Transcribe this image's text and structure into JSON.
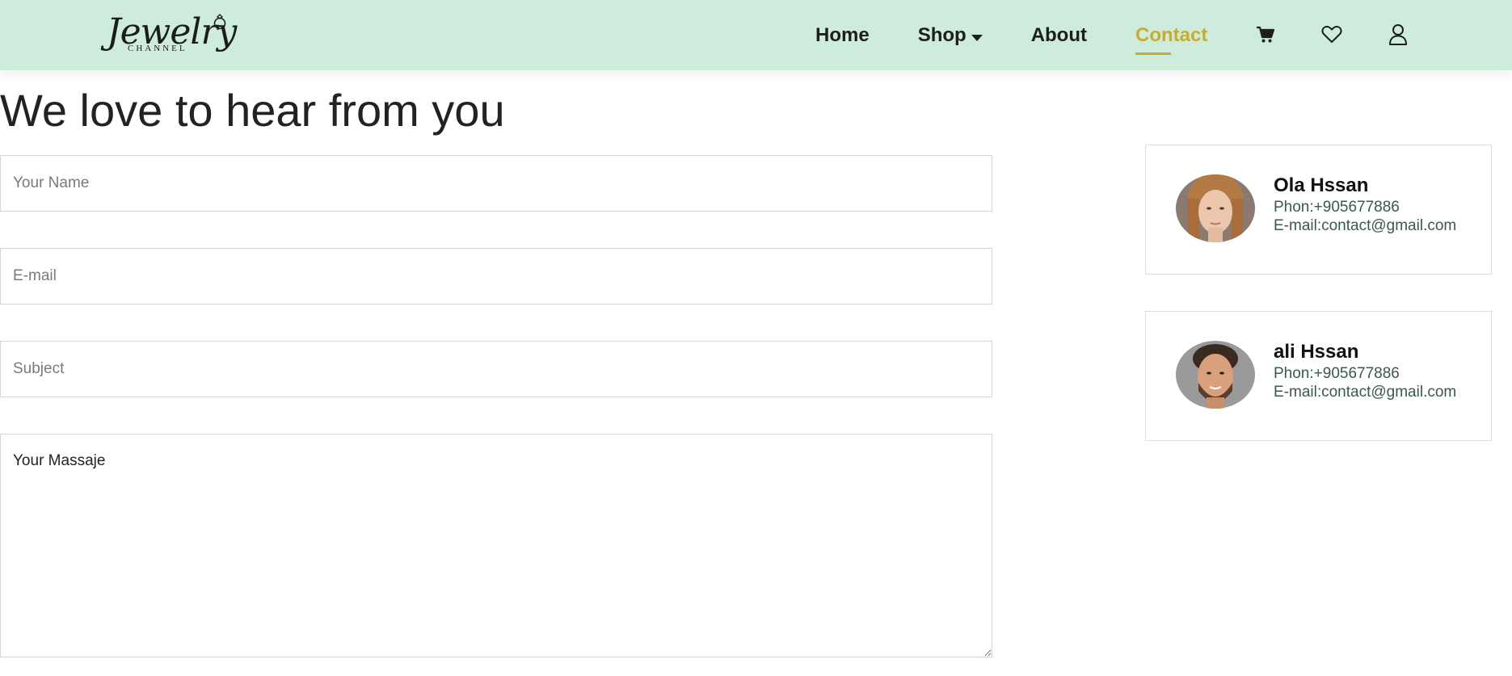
{
  "brand": {
    "logo_script": "Jewelry",
    "logo_sub": "CHANNEL"
  },
  "nav": {
    "items": [
      {
        "label": "Home"
      },
      {
        "label": "Shop"
      },
      {
        "label": "About"
      },
      {
        "label": "Contact",
        "active": true
      }
    ],
    "icons": [
      "cart-icon",
      "heart-icon",
      "user-icon"
    ],
    "active_color": "#c9ac2f",
    "background": "#cdecdb"
  },
  "page": {
    "title": "We love to hear from you"
  },
  "form": {
    "name_placeholder": "Your Name",
    "email_placeholder": "E-mail",
    "subject_placeholder": "Subject",
    "message_placeholder": "Your Massaje"
  },
  "contacts": [
    {
      "name": "Ola Hssan",
      "phone": "Phon:+905677886",
      "email": "E-mail:contact@gmail.com"
    },
    {
      "name": "ali Hssan",
      "phone": "Phon:+905677886",
      "email": "E-mail:contact@gmail.com"
    }
  ]
}
